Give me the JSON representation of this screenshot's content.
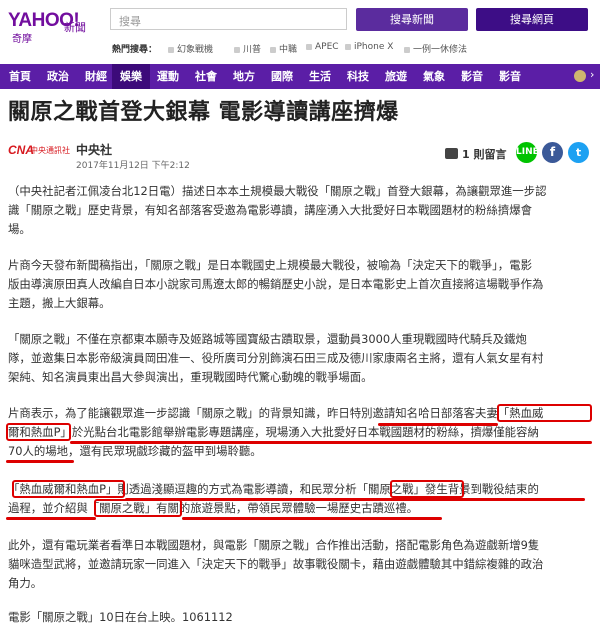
{
  "header": {
    "logo": "YAHOO!",
    "logo_sub1": "新聞",
    "logo_sub2": "奇摩",
    "search_placeholder": "搜尋",
    "search_news_button": "搜尋新聞",
    "search_web_button": "搜尋網頁",
    "hot_label": "熱門搜尋：",
    "hot_items": [
      "幻象戰機",
      "川普",
      "中職",
      "APEC",
      "iPhone X",
      "一例一休修法"
    ]
  },
  "nav": {
    "items": [
      "首頁",
      "政治",
      "財經",
      "娛樂",
      "運動",
      "社會",
      "地方",
      "國際",
      "生活",
      "科技",
      "旅遊",
      "氣象",
      "影音",
      "影音"
    ],
    "active_index": 3
  },
  "article": {
    "title": "關原之戰首登大銀幕 電影導讀講座擠爆",
    "source_logo": "CNA",
    "source_logo_text": "中央通訊社",
    "source_name": "中央社",
    "pubtime": "2017年11月12日 下午2:12",
    "comment_count": "1 則留言",
    "share_line": "LINE",
    "paragraphs": [
      {
        "lines": [
          "（中央社記者江佩凌台北12日電）描述日本本土規模最大戰役「關原之戰」首登大銀幕，為讓觀眾進一步認",
          "識「關原之戰」歷史背景，有知名部落客受邀為電影導讀，講座湧入大批愛好日本戰國題材的粉絲擠爆會",
          "場。"
        ]
      },
      {
        "lines": [
          "片商今天發布新聞稿指出，「關原之戰」是日本戰國史上規模最大戰役，被喻為「決定天下的戰爭」，電影",
          "版由導演原田真人改編自日本小說家司馬遼太郎的暢銷歷史小說，是日本電影史上首次直接將這場戰爭作為",
          "主題，搬上大銀幕。"
        ]
      },
      {
        "lines": [
          "「關原之戰」不僅在京都東本願寺及姬路城等國寶級古蹟取景，還動員3000人重現戰國時代騎兵及鐵炮",
          "隊，並邀集日本影帝級演員岡田准一、役所廣司分別飾演石田三成及德川家康兩名主將，還有人氣女星有村",
          "架純、知名演員東出昌大參與演出，重現戰國時代驚心動魄的戰爭場面。"
        ]
      },
      {
        "lines": [
          "片商表示，為了能讓觀眾進一步認識「關原之戰」的背景知識，昨日特別邀請知名哈日部落客夫妻「熱血威",
          "爾和熱血P」於光點台北電影館舉辦電影專題講座，現場湧入大批愛好日本戰國題材的粉絲，擠爆僅能容納",
          "70人的場地，還有民眾現戲珍藏的盔甲到場聆聽。"
        ]
      },
      {
        "lines": [
          "「熱血威爾和熱血P」則透過淺顯逗趣的方式為電影導讀，和民眾分析「關原之戰」發生背景到戰役結束的",
          "過程，並介紹與「關原之戰」有關的旅遊景點，帶領民眾體驗一場歷史古蹟巡禮。"
        ]
      },
      {
        "lines": [
          "此外，還有電玩業者看準日本戰國題材，與電影「關原之戰」合作推出活動，搭配電影角色為遊戲新增9隻",
          "貓咪造型武將，並邀請玩家一同進入「決定天下的戰爭」故事戰役關卡，藉由遊戲體驗其中錯綜複雜的政治",
          "角力。"
        ]
      },
      {
        "lines": [
          "電影「關原之戰」10日在台上映。1061112"
        ]
      }
    ]
  },
  "colors": {
    "brand": "#720e9e",
    "nav_bg": "#5b1ea6",
    "highlight": "#dd0000"
  }
}
